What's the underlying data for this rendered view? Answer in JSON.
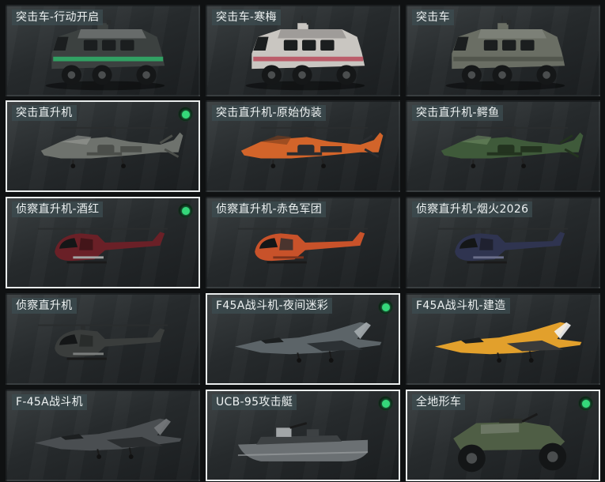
{
  "items": [
    {
      "label": "突击车-行动开启",
      "selected": false,
      "equipped": false,
      "kind": "apc",
      "colors": [
        "#3c4140",
        "#2fb36a",
        "#8a8e8d"
      ]
    },
    {
      "label": "突击车-寒梅",
      "selected": false,
      "equipped": false,
      "kind": "apc",
      "colors": [
        "#c9c6c1",
        "#b84a5b",
        "#7c7a78"
      ]
    },
    {
      "label": "突击车",
      "selected": false,
      "equipped": false,
      "kind": "apc",
      "colors": [
        "#6a6e64",
        "#4e5249",
        "#8b8f86"
      ]
    },
    {
      "label": "突击直升机",
      "selected": true,
      "equipped": true,
      "kind": "attack-heli",
      "colors": [
        "#6e726d",
        "#4b4e4a",
        "#9a9d98"
      ]
    },
    {
      "label": "突击直升机-原始伪装",
      "selected": false,
      "equipped": false,
      "kind": "attack-heli",
      "colors": [
        "#d2642a",
        "#2a2d30",
        "#7d3d1c"
      ]
    },
    {
      "label": "突击直升机-鳄鱼",
      "selected": false,
      "equipped": false,
      "kind": "attack-heli",
      "colors": [
        "#3f5a3a",
        "#23331f",
        "#6e8a62"
      ]
    },
    {
      "label": "侦察直升机-酒红",
      "selected": true,
      "equipped": true,
      "kind": "scout-heli",
      "colors": [
        "#6a2027",
        "#3a1317",
        "#a2a4a3"
      ]
    },
    {
      "label": "侦察直升机-赤色军团",
      "selected": false,
      "equipped": false,
      "kind": "scout-heli",
      "colors": [
        "#c8522a",
        "#2b2d2f",
        "#7e331c"
      ]
    },
    {
      "label": "侦察直升机-烟火2026",
      "selected": false,
      "equipped": false,
      "kind": "scout-heli",
      "colors": [
        "#2f3450",
        "#1b1d28",
        "#6a6e8a"
      ]
    },
    {
      "label": "侦察直升机",
      "selected": false,
      "equipped": false,
      "kind": "scout-heli",
      "colors": [
        "#3a3d3c",
        "#252827",
        "#7a7d7c"
      ]
    },
    {
      "label": "F45A战斗机-夜间迷彩",
      "selected": true,
      "equipped": true,
      "kind": "jet",
      "colors": [
        "#5c6468",
        "#2c3134",
        "#a4abae"
      ]
    },
    {
      "label": "F45A战斗机-建造",
      "selected": false,
      "equipped": false,
      "kind": "jet",
      "colors": [
        "#e2a02c",
        "#3a3a3a",
        "#f2f2f2"
      ]
    },
    {
      "label": "F-45A战斗机",
      "selected": false,
      "equipped": false,
      "kind": "jet",
      "colors": [
        "#4a4e51",
        "#2b2e30",
        "#76797b"
      ]
    },
    {
      "label": "UCB-95攻击艇",
      "selected": true,
      "equipped": true,
      "kind": "boat",
      "colors": [
        "#6b7073",
        "#3d4143",
        "#a2a6a8"
      ]
    },
    {
      "label": "全地形车",
      "selected": true,
      "equipped": true,
      "kind": "atv",
      "colors": [
        "#4f5e45",
        "#2b2e2a",
        "#8a8f84"
      ]
    }
  ]
}
